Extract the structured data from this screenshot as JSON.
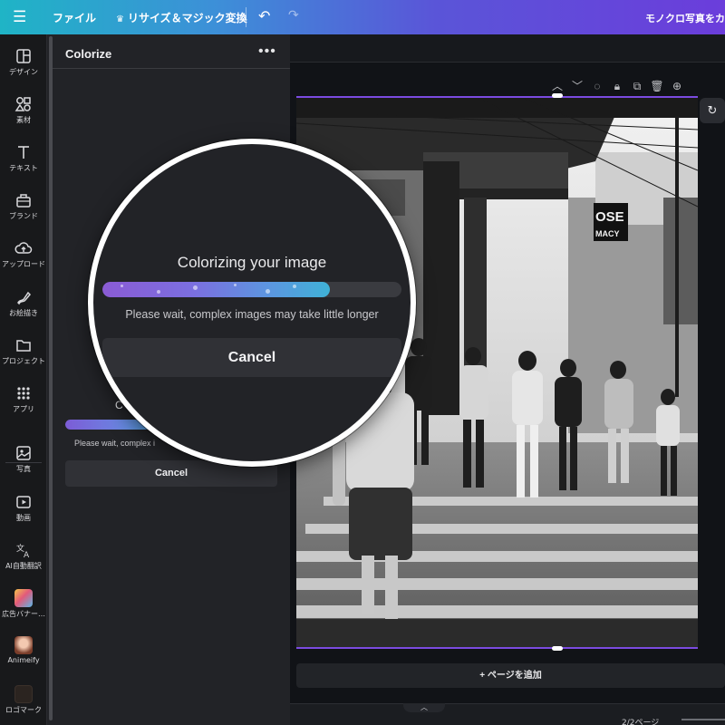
{
  "topbar": {
    "menu_icon": "hamburger-icon",
    "file_label": "ファイル",
    "resize_label": "リサイズ＆マジック変換",
    "doc_title": "モノクロ写真をカラー"
  },
  "rail": {
    "items": [
      {
        "label": "デザイン",
        "icon": "layout-icon"
      },
      {
        "label": "素材",
        "icon": "shapes-icon"
      },
      {
        "label": "テキスト",
        "icon": "text-icon"
      },
      {
        "label": "ブランド",
        "icon": "brand-icon"
      },
      {
        "label": "アップロード",
        "icon": "upload-icon"
      },
      {
        "label": "お絵描き",
        "icon": "draw-icon"
      },
      {
        "label": "プロジェクト",
        "icon": "folder-icon"
      },
      {
        "label": "アプリ",
        "icon": "apps-icon"
      },
      {
        "label": "写真",
        "icon": "photo-icon"
      },
      {
        "label": "動画",
        "icon": "video-icon"
      },
      {
        "label": "AI自動翻訳",
        "icon": "translate-icon"
      },
      {
        "label": "広告バナー…",
        "icon": "app-thumbnail"
      },
      {
        "label": "Animeify",
        "icon": "app-thumbnail"
      },
      {
        "label": "ロゴマーク",
        "icon": "app-thumbnail"
      }
    ]
  },
  "panel": {
    "title": "Colorize",
    "more_icon": "more-horizontal-icon",
    "progress_title_partial": "C",
    "progress_message_partial": "Please wait, complex i",
    "progress": 0.44,
    "cancel_label": "Cancel"
  },
  "magnifier": {
    "title": "Colorizing your image",
    "message": "Please wait, complex images may take little longer",
    "progress": 0.76,
    "cancel_label": "Cancel"
  },
  "canvas": {
    "add_page_label": "+ ページを追加",
    "page_count": "2/2ページ",
    "photo_sign_1": "OSE",
    "photo_sign_2": "MACY"
  },
  "colors": {
    "accent": "#7b4be0",
    "panel_bg": "#222327",
    "rail_bg": "#18191b"
  }
}
